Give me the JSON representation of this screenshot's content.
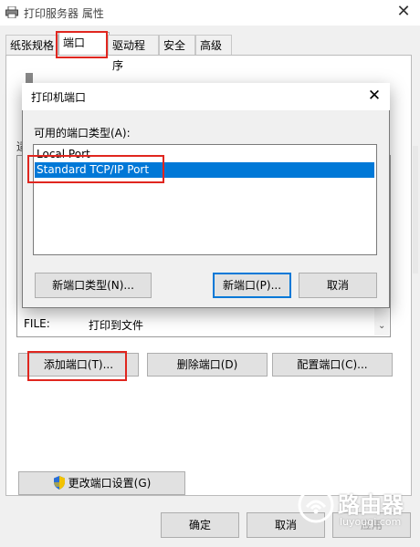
{
  "window": {
    "title": "打印服务器 属性"
  },
  "tabs": [
    {
      "label": "纸张规格"
    },
    {
      "label": "端口"
    },
    {
      "label": "驱动程序"
    },
    {
      "label": "安全"
    },
    {
      "label": "高级"
    }
  ],
  "port_list": {
    "side_label": "适",
    "row_file": {
      "name": "FILE:",
      "description": "打印到文件"
    }
  },
  "buttons": {
    "add_port": "添加端口(T)...",
    "delete_port": "删除端口(D)",
    "configure_port": "配置端口(C)...",
    "change_port_settings": "更改端口设置(G)",
    "ok": "确定",
    "cancel": "取消",
    "apply": "应用"
  },
  "dialog": {
    "title": "打印机端口",
    "available_types_label": "可用的端口类型(A):",
    "types": [
      "Local Port",
      "Standard TCP/IP Port"
    ],
    "selected_type": "Standard TCP/IP Port",
    "buttons": {
      "new_port_type": "新端口类型(N)...",
      "new_port": "新端口(P)...",
      "cancel": "取消"
    }
  },
  "watermark": {
    "text": "路由器",
    "url": "luyouqi.com"
  },
  "colors": {
    "highlight_red": "#e0261f",
    "selection_blue": "#0078d7"
  }
}
